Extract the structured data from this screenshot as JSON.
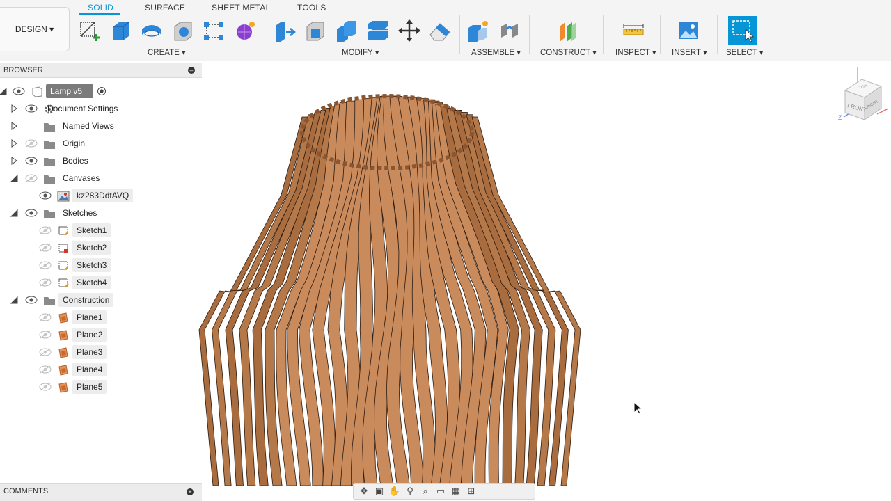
{
  "workspace_button": "DESIGN ▾",
  "tabs": [
    "SOLID",
    "SURFACE",
    "SHEET METAL",
    "TOOLS"
  ],
  "groups": {
    "create": "CREATE ▾",
    "modify": "MODIFY ▾",
    "assemble": "ASSEMBLE ▾",
    "construct": "CONSTRUCT ▾",
    "inspect": "INSPECT ▾",
    "insert": "INSERT ▾",
    "select": "SELECT ▾"
  },
  "browser": {
    "title": "BROWSER",
    "root": "Lamp v5",
    "items": [
      {
        "label": "Document Settings",
        "icon": "gear-icon"
      },
      {
        "label": "Named Views",
        "icon": "folder-icon"
      },
      {
        "label": "Origin",
        "icon": "folder-icon"
      },
      {
        "label": "Bodies",
        "icon": "folder-icon"
      },
      {
        "label": "Canvases",
        "icon": "folder-icon"
      },
      {
        "label": "kz283DdtAVQ",
        "icon": "canvas-image-icon"
      },
      {
        "label": "Sketches",
        "icon": "folder-icon"
      },
      {
        "label": "Sketch1",
        "icon": "sketch-icon"
      },
      {
        "label": "Sketch2",
        "icon": "sketch-locked-icon"
      },
      {
        "label": "Sketch3",
        "icon": "sketch-icon"
      },
      {
        "label": "Sketch4",
        "icon": "sketch-icon"
      },
      {
        "label": "Construction",
        "icon": "folder-icon"
      },
      {
        "label": "Plane1",
        "icon": "plane-icon"
      },
      {
        "label": "Plane2",
        "icon": "plane-icon"
      },
      {
        "label": "Plane3",
        "icon": "plane-icon"
      },
      {
        "label": "Plane4",
        "icon": "plane-icon"
      },
      {
        "label": "Plane5",
        "icon": "plane-icon"
      }
    ]
  },
  "comments": {
    "title": "COMMENTS"
  },
  "viewcube": {
    "top": "TOP",
    "front": "FRONT",
    "right": "RIGHT",
    "axis_z": "Z"
  },
  "colors": {
    "accent": "#0696d7",
    "wood": "#c98a5c",
    "wood_dark": "#8a5530"
  }
}
